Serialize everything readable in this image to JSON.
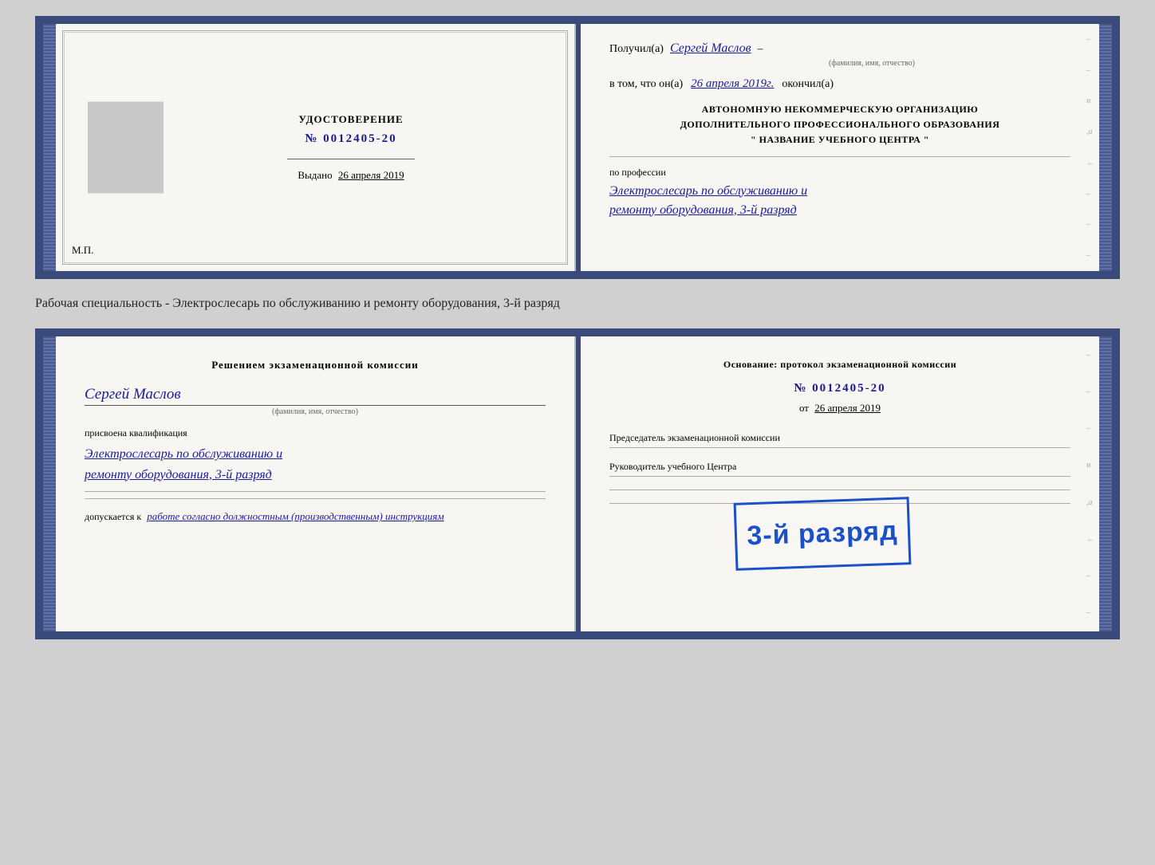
{
  "cert": {
    "header_center": "НАЗВАНИЕ УЧЕБНОГО ЦЕНТРА",
    "title": "УДОСТОВЕРЕНИЕ",
    "number": "№ 0012405-20",
    "issued_label": "Выдано",
    "issued_date": "26 апреля 2019",
    "mp_label": "М.П.",
    "right_intro": "Получил(а)",
    "recipient_name": "Сергей Маслов",
    "recipient_subtitle": "(фамилия, имя, отчество)",
    "dash": "–",
    "in_that": "в том, что он(а)",
    "completed_date": "26 апреля 2019г.",
    "completed_label": "окончил(а)",
    "org_text1": "АВТОНОМНУЮ НЕКОММЕРЧЕСКУЮ ОРГАНИЗАЦИЮ",
    "org_text2": "ДОПОЛНИТЕЛЬНОГО ПРОФЕССИОНАЛЬНОГО ОБРАЗОВАНИЯ",
    "org_name": "\" НАЗВАНИЕ УЧЕБНОГО ЦЕНТРА \"",
    "profession_label": "по профессии",
    "profession_line1": "Электрослесарь по обслуживанию и",
    "profession_line2": "ремонту оборудования, 3-й разряд"
  },
  "separator": {
    "text": "Рабочая специальность - Электрослесарь по обслуживанию и ремонту оборудования, 3-й разряд"
  },
  "qual": {
    "left_title": "Решением экзаменационной комиссии",
    "person_name": "Сергей Маслов",
    "person_subtitle": "(фамилия, имя, отчество)",
    "assigned_label": "присвоена квалификация",
    "qualification_line1": "Электрослесарь по обслуживанию и",
    "qualification_line2": "ремонту оборудования, 3-й разряд",
    "admitted_prefix": "допускается к",
    "admitted_text": "работе согласно должностным (производственным) инструкциям",
    "right_title": "Основание: протокол экзаменационной комиссии",
    "protocol_number": "№ 0012405-20",
    "protocol_date_prefix": "от",
    "protocol_date": "26 апреля 2019",
    "chairman_label": "Председатель экзаменационной комиссии",
    "director_label": "Руководитель учебного Центра",
    "stamp_text": "3-й разряд"
  }
}
